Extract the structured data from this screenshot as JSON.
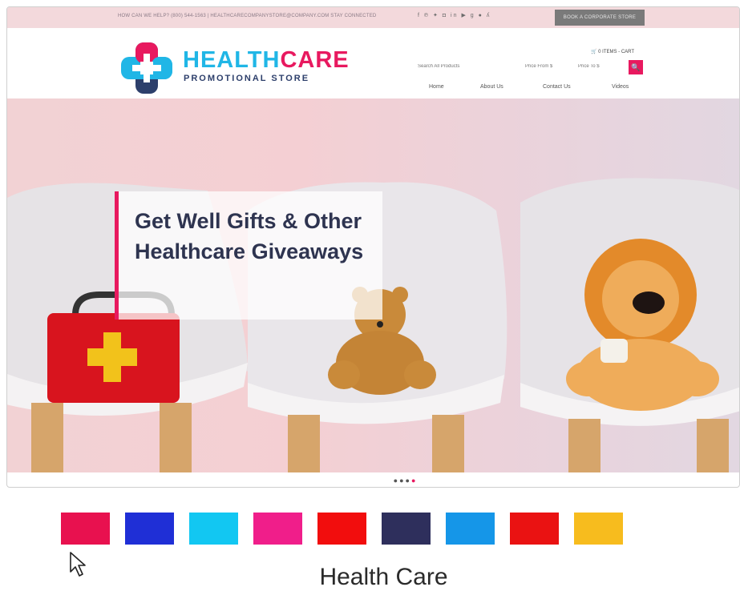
{
  "topbar": {
    "help_text": "HOW CAN WE HELP?  (800) 544-1563  |  HEALTHCARECOMPANYSTORE@COMPANY.COM     STAY CONNECTED",
    "social_icons": [
      "facebook-icon",
      "pinterest-icon",
      "twitter-icon",
      "instagram-icon",
      "linkedin-icon",
      "youtube-icon",
      "google-plus-icon",
      "blog-icon",
      "rss-icon"
    ],
    "corporate_button": "BOOK A CORPORATE STORE"
  },
  "logo": {
    "title_health": "HEALTH",
    "title_care": "CARE",
    "subtitle": "PROMOTIONAL STORE"
  },
  "cart": {
    "label": "0 ITEMS - CART"
  },
  "search": {
    "all_products_placeholder": "Search All Products",
    "price_from_placeholder": "Price From $",
    "price_to_placeholder": "Price To $"
  },
  "nav": {
    "items": [
      {
        "label": "Home"
      },
      {
        "label": "About Us"
      },
      {
        "label": "Contact Us"
      },
      {
        "label": "Videos"
      }
    ]
  },
  "hero": {
    "caption": "Get Well Gifts & Other Healthcare Giveaways",
    "dots": 4,
    "active_dot": 4
  },
  "palette": {
    "swatches": [
      "#e8114f",
      "#1f2fd6",
      "#12c7f2",
      "#f01e8a",
      "#f20d0d",
      "#2e2f5c",
      "#1596e8",
      "#ea1212",
      "#f7bc1e"
    ]
  },
  "bottom_title": "Health Care",
  "colors": {
    "accent_pink": "#e8195f",
    "accent_blue": "#20b6e6",
    "navy": "#2d3f6b"
  }
}
